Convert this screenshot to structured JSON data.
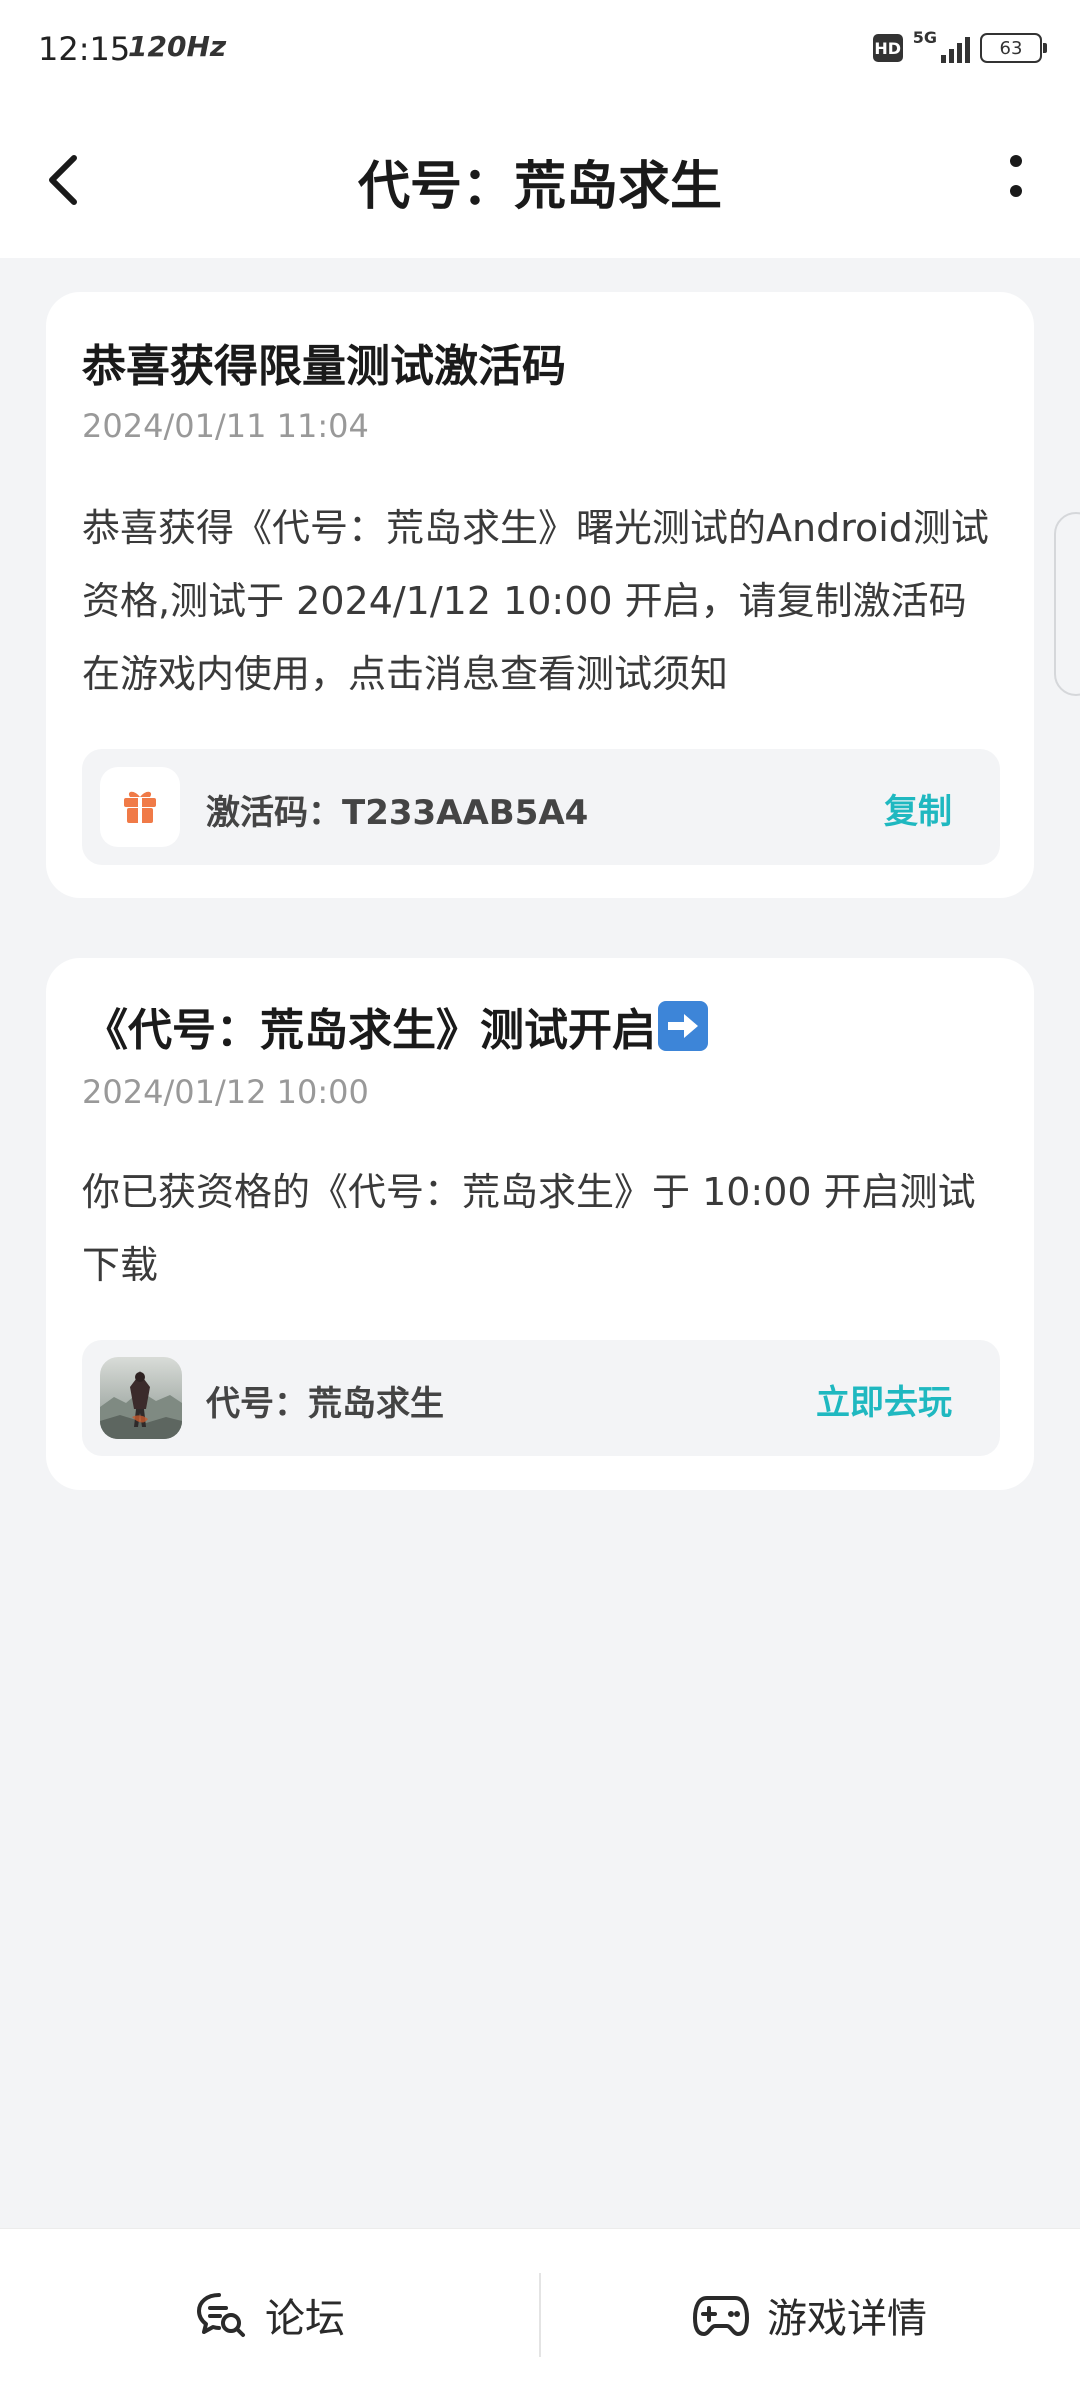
{
  "status_bar": {
    "time": "12:15",
    "refresh_rate": "120Hz",
    "hd": "HD",
    "network": "5G",
    "battery": "63"
  },
  "header": {
    "title": "代号：荒岛求生"
  },
  "messages": [
    {
      "title": "恭喜获得限量测试激活码",
      "time": "2024/01/11 11:04",
      "body": "恭喜获得《代号：荒岛求生》曙光测试的Android测试资格,测试于 2024/1/12 10:00 开启，请复制激活码在游戏内使用，点击消息查看测试须知",
      "action_label": "激活码：T233AAB5A4",
      "action_button": "复制",
      "icon": "gift-icon"
    },
    {
      "title": "《代号：荒岛求生》测试开启",
      "time": "2024/01/12 10:00",
      "body": "你已获资格的《代号：荒岛求生》于 10:00 开启测试下载",
      "action_label": "代号：荒岛求生",
      "action_button": "立即去玩",
      "icon": "game-thumbnail"
    }
  ],
  "bottom_bar": {
    "forum_label": "论坛",
    "details_label": "游戏详情"
  },
  "colors": {
    "accent": "#1fb8c0",
    "gift": "#f07a47",
    "background": "#f3f4f6"
  }
}
